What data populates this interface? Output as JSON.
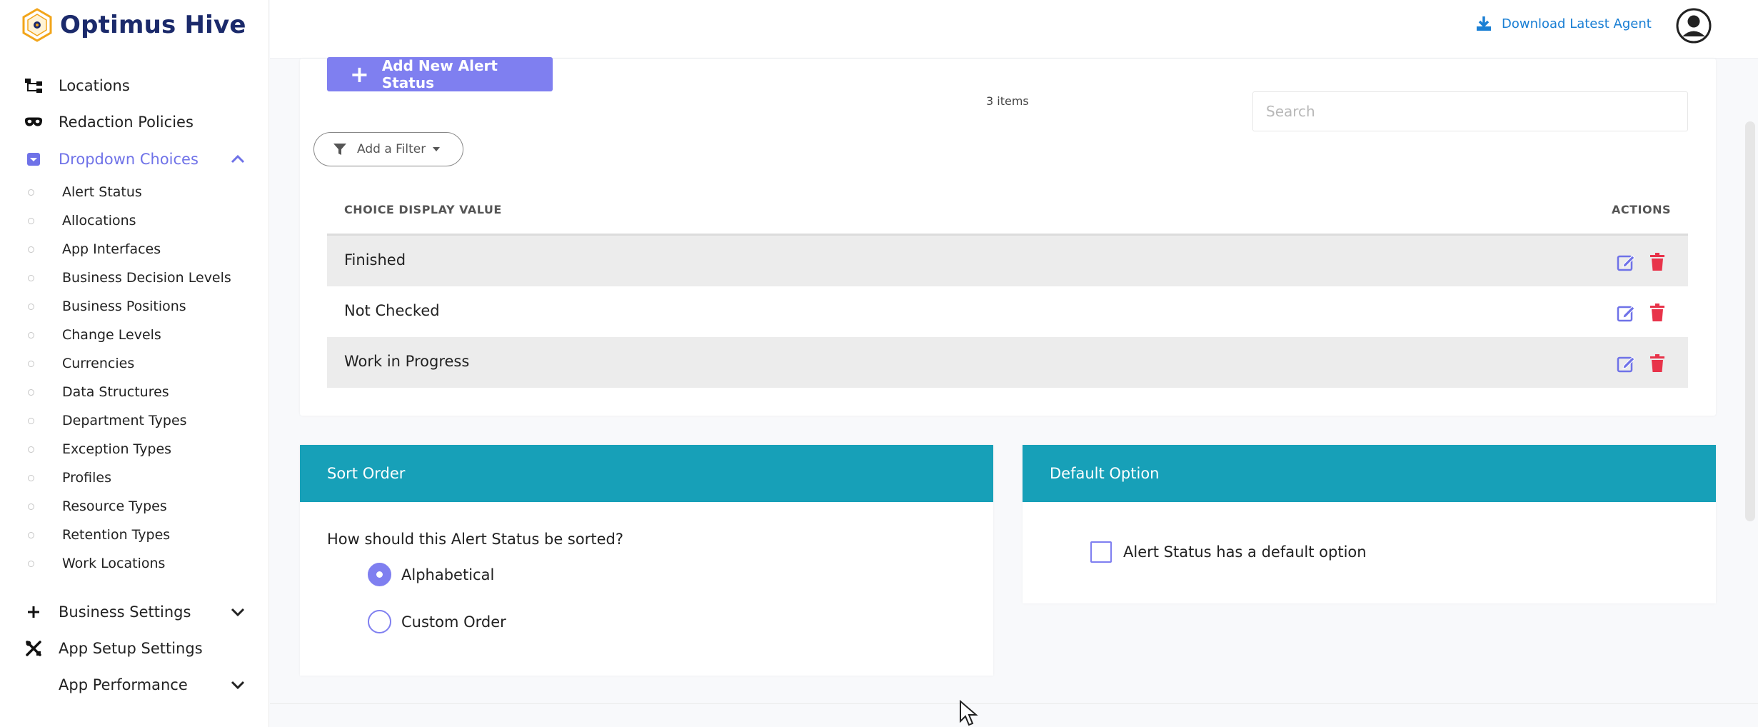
{
  "brand": {
    "name": "Optimus Hive"
  },
  "header": {
    "download_label": "Download Latest Agent"
  },
  "sidebar": {
    "top_items": [
      {
        "label": "Locations",
        "icon": "hierarchy-icon"
      },
      {
        "label": "Redaction Policies",
        "icon": "mask-icon"
      }
    ],
    "active_section": {
      "label": "Dropdown Choices",
      "icon": "dropdown-square-icon"
    },
    "sub_items": [
      "Alert Status",
      "Allocations",
      "App Interfaces",
      "Business Decision Levels",
      "Business Positions",
      "Change Levels",
      "Currencies",
      "Data Structures",
      "Department Types",
      "Exception Types",
      "Profiles",
      "Resource Types",
      "Retention Types",
      "Work Locations"
    ],
    "bottom_items": [
      {
        "label": "Business Settings",
        "icon": "plus-icon"
      },
      {
        "label": "App Setup Settings",
        "icon": "tools-icon"
      },
      {
        "label": "App Performance",
        "icon": ""
      }
    ]
  },
  "main": {
    "add_button_label": "Add New Alert Status",
    "items_count": "3 items",
    "search_placeholder": "Search",
    "filter_label": "Add a Filter",
    "table": {
      "columns": [
        "CHOICE DISPLAY VALUE",
        "ACTIONS"
      ],
      "rows": [
        "Finished",
        "Not Checked",
        "Work in Progress"
      ]
    }
  },
  "sort_panel": {
    "title": "Sort Order",
    "question": "How should this Alert Status be sorted?",
    "options": [
      "Alphabetical",
      "Custom Order"
    ],
    "selected": "Alphabetical"
  },
  "default_panel": {
    "title": "Default Option",
    "checkbox_label": "Alert Status has a default option",
    "checked": false
  },
  "colors": {
    "accent": "#7f7ff0",
    "panel_header": "#17a0b8",
    "brand_text": "#1b2a6b",
    "link": "#1a7fd4",
    "delete": "#e8334a"
  }
}
